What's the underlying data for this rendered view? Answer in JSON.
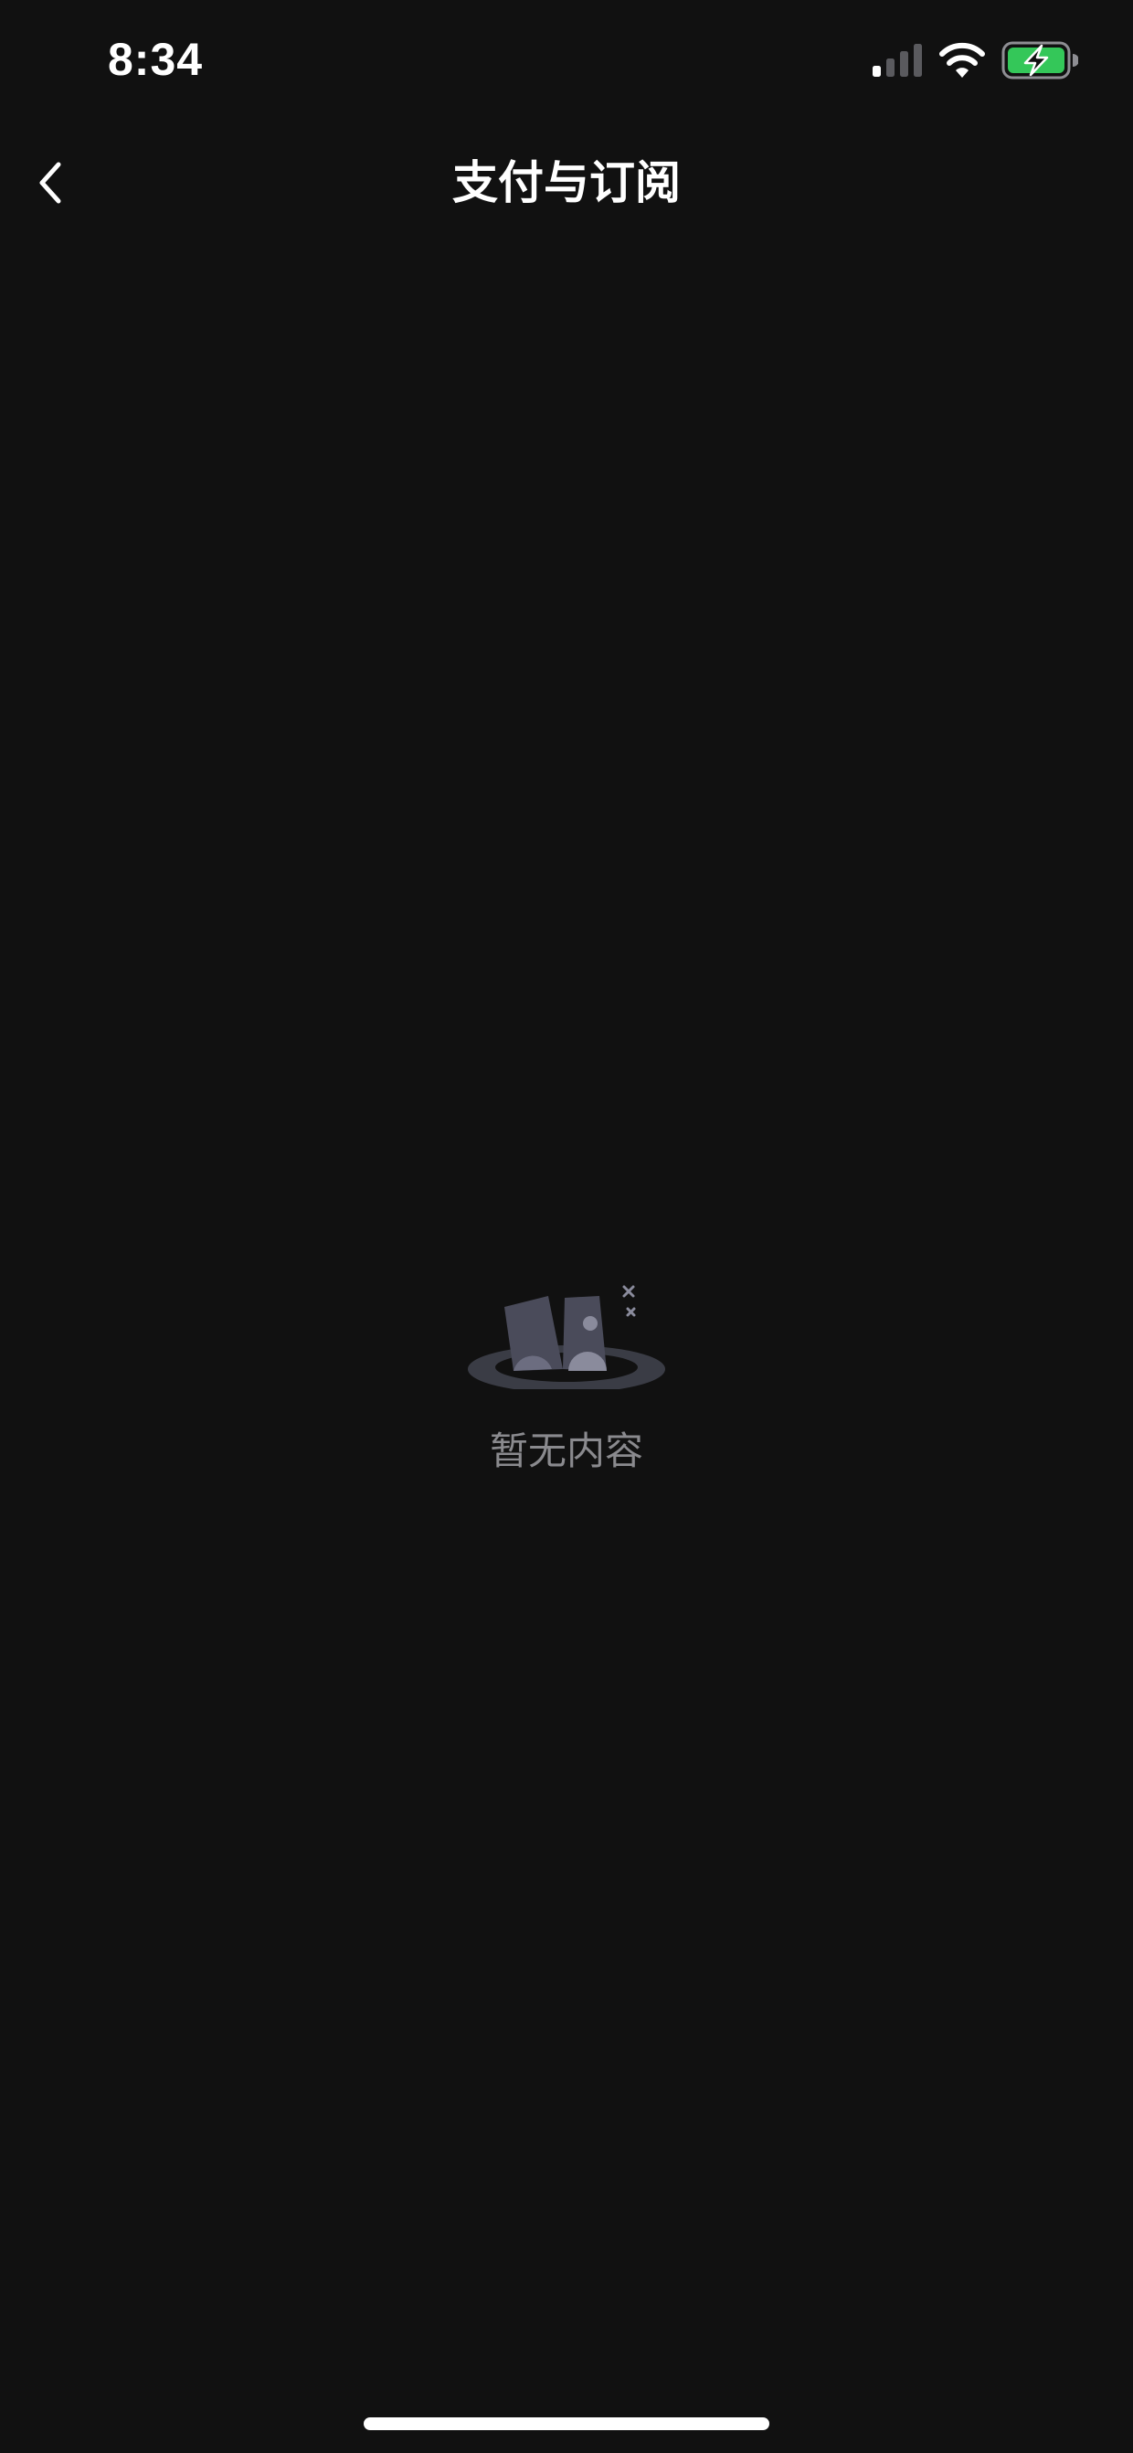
{
  "status_bar": {
    "time": "8:34",
    "signal_icon": "cellular-signal-icon",
    "wifi_icon": "wifi-icon",
    "battery_icon": "battery-charging-icon",
    "battery_color": "#34c759"
  },
  "nav_bar": {
    "back_icon": "chevron-left-icon",
    "title": "支付与订阅"
  },
  "empty_state": {
    "illustration_icon": "empty-box-icon",
    "message": "暂无内容"
  },
  "colors": {
    "background": "#111111",
    "text_primary": "#ffffff",
    "text_secondary": "#8a8a8e"
  }
}
